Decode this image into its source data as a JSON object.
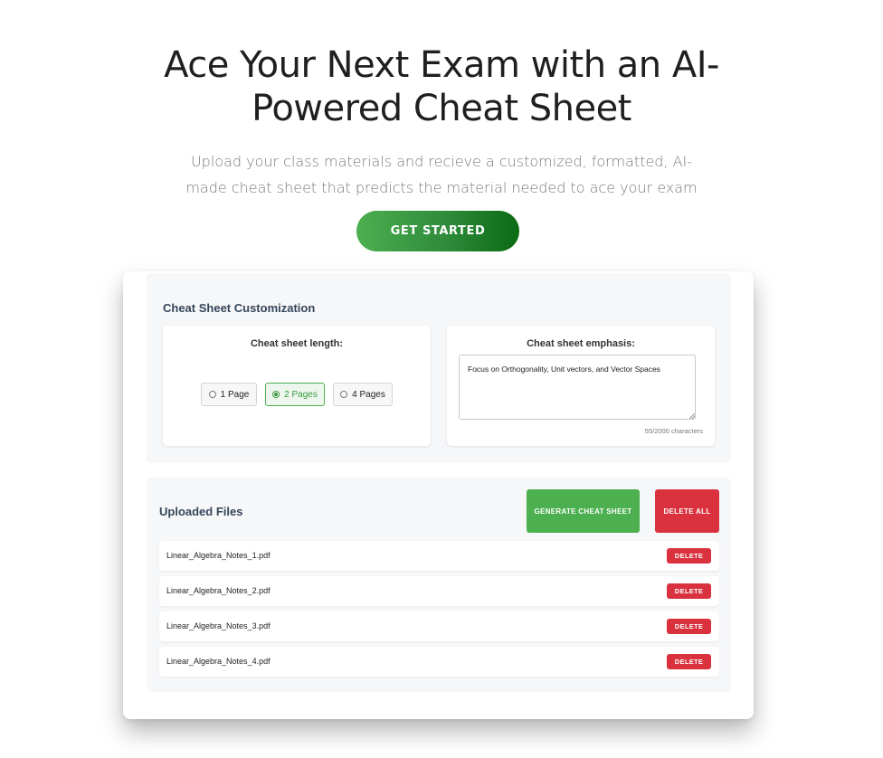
{
  "hero": {
    "title_line1": "Ace Your Next Exam with an AI-",
    "title_line2": "Powered Cheat Sheet",
    "subtitle_line1": "Upload your class materials and recieve a customized, formatted, AI-",
    "subtitle_line2": "made cheat sheet that predicts the material needed to ace your exam",
    "cta_label": "GET STARTED"
  },
  "customization": {
    "title": "Cheat Sheet Customization",
    "length": {
      "heading": "Cheat sheet length:",
      "options": [
        "1 Page",
        "2 Pages",
        "4 Pages"
      ],
      "selected": "2 Pages"
    },
    "emphasis": {
      "heading": "Cheat sheet emphasis:",
      "value": "Focus on Orthogonality, Unit vectors, and Vector Spaces",
      "char_count": "55/2000 characters"
    }
  },
  "files": {
    "title": "Uploaded Files",
    "generate_label": "GENERATE CHEAT SHEET",
    "delete_all_label": "DELETE ALL",
    "delete_label": "DELETE",
    "items": [
      "Linear_Algebra_Notes_1.pdf",
      "Linear_Algebra_Notes_2.pdf",
      "Linear_Algebra_Notes_3.pdf",
      "Linear_Algebra_Notes_4.pdf"
    ]
  },
  "colors": {
    "accent_green": "#4caf50",
    "danger_red": "#d9323e",
    "panel_bg": "#f6f7f9"
  }
}
